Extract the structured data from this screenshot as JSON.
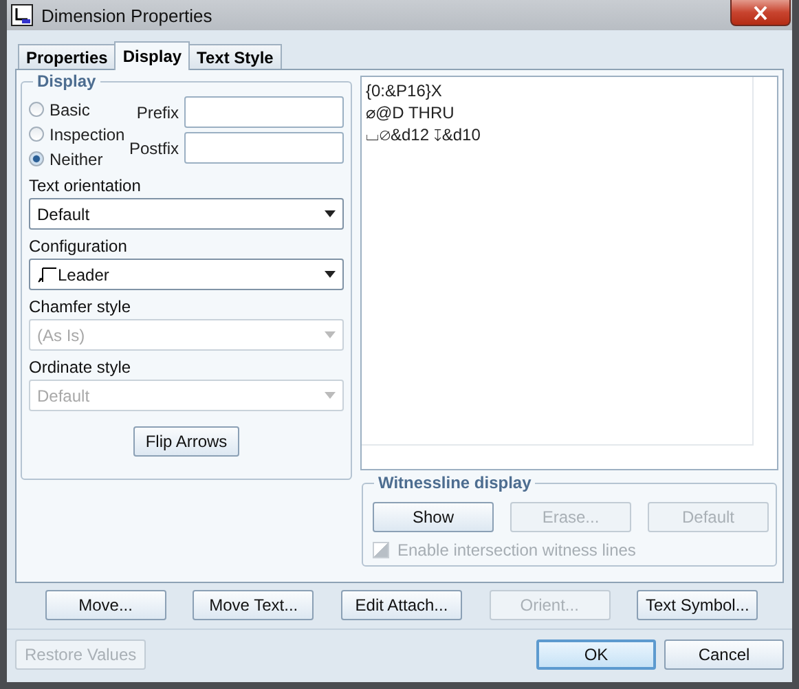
{
  "window": {
    "title": "Dimension Properties"
  },
  "tabs": [
    {
      "label": "Properties",
      "selected": false
    },
    {
      "label": "Display",
      "selected": true
    },
    {
      "label": "Text Style",
      "selected": false
    }
  ],
  "display_group": {
    "title": "Display",
    "radios": [
      {
        "label": "Basic",
        "selected": false
      },
      {
        "label": "Inspection",
        "selected": false
      },
      {
        "label": "Neither",
        "selected": true
      }
    ],
    "prefix": {
      "label": "Prefix"
    },
    "postfix": {
      "label": "Postfix"
    }
  },
  "dropdowns": [
    {
      "label": "Text orientation",
      "value": "Default",
      "disabled": false,
      "kind": "plain"
    },
    {
      "label": "Configuration",
      "value": "Leader",
      "disabled": false,
      "kind": "leader"
    },
    {
      "label": "Chamfer style",
      "value": "(As Is)",
      "disabled": true,
      "kind": "plain"
    },
    {
      "label": "Ordinate style",
      "value": "Default",
      "disabled": true,
      "kind": "plain"
    }
  ],
  "flip_button": {
    "label": "Flip Arrows"
  },
  "text_area": {
    "lines": [
      "{0:&P16}X",
      "⌀@D THRU",
      "⌴⌀&d12 ↧&d10"
    ]
  },
  "witnessline": {
    "title": "Witnessline display",
    "buttons": [
      {
        "label": "Show",
        "disabled": false
      },
      {
        "label": "Erase...",
        "disabled": true
      },
      {
        "label": "Default",
        "disabled": true
      }
    ],
    "checkbox": {
      "label": "Enable intersection witness lines",
      "checked": true,
      "disabled": true
    }
  },
  "action_buttons": [
    {
      "label": "Move...",
      "disabled": false
    },
    {
      "label": "Move Text...",
      "disabled": false
    },
    {
      "label": "Edit Attach...",
      "disabled": false
    },
    {
      "label": "Orient...",
      "disabled": true
    },
    {
      "label": "Text Symbol...",
      "disabled": false
    }
  ],
  "restore_button": {
    "label": "Restore Values",
    "disabled": true
  },
  "dialog_buttons": [
    {
      "label": "OK",
      "default": true
    },
    {
      "label": "Cancel",
      "default": false
    }
  ]
}
